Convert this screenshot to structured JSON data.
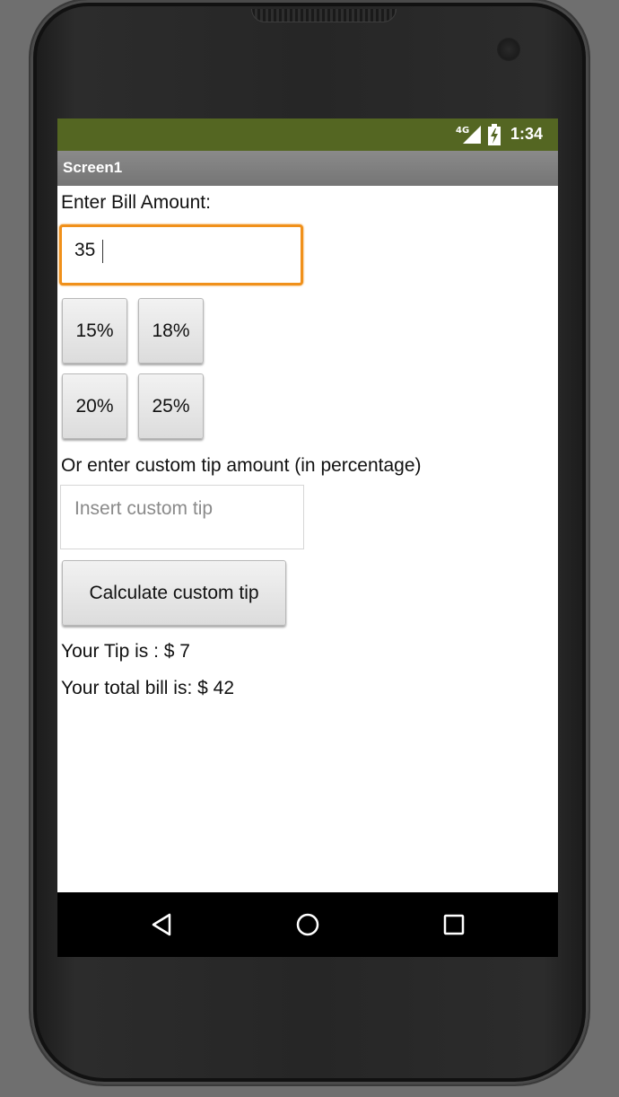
{
  "status_bar": {
    "network": "4G",
    "time": "1:34"
  },
  "title_bar": {
    "title": "Screen1"
  },
  "form": {
    "bill_label": "Enter Bill Amount:",
    "bill_value": "35",
    "tip_buttons": [
      "15%",
      "18%",
      "20%",
      "25%"
    ],
    "custom_label": "Or enter custom tip amount (in percentage)",
    "custom_placeholder": "Insert custom tip",
    "calculate_label": "Calculate custom tip",
    "tip_result": "Your Tip is : $ 7",
    "total_result": "Your total bill is: $ 42"
  },
  "nav_bar": {
    "icons": [
      "back-icon",
      "home-icon",
      "recents-icon"
    ]
  },
  "colors": {
    "status_bar": "#546622",
    "focus_border": "#f0901a"
  }
}
